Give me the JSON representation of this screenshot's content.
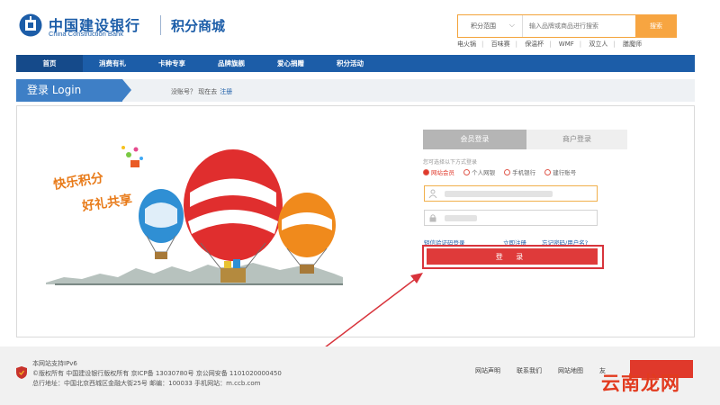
{
  "header": {
    "bank_name_cn": "中国建设银行",
    "bank_name_en": "China Construction Bank",
    "mall_title": "积分商城",
    "search": {
      "scope_label": "积分范围",
      "placeholder": "输入品牌或商品进行搜索",
      "button_label": "搜索"
    },
    "hot_words": [
      "电火锅",
      "百味赛",
      "保温杯",
      "WMF",
      "双立人",
      "膳魔师"
    ]
  },
  "nav": {
    "items": [
      {
        "label": "首页",
        "active": true
      },
      {
        "label": "消费有礼"
      },
      {
        "label": "卡种专享"
      },
      {
        "label": "品牌旗舰"
      },
      {
        "label": "爱心捐赠"
      },
      {
        "label": "积分活动"
      }
    ]
  },
  "login_bar": {
    "title": "登录 Login",
    "no_account_text": "没账号？ 现在去",
    "register_link": "注册"
  },
  "illustration": {
    "slogan_line1": "快乐积分",
    "slogan_line2": "好礼共享"
  },
  "login_form": {
    "tab_member": "会员登录",
    "tab_merchant": "商户登录",
    "methods_hint": "您可选择以下方式登录",
    "methods": [
      {
        "label": "网站会员",
        "selected": true
      },
      {
        "label": "个人网银"
      },
      {
        "label": "手机银行"
      },
      {
        "label": "建行账号"
      }
    ],
    "sms_login_link": "短信验证码登录",
    "register_now_link": "立即注册",
    "forgot_link": "忘记密码/用户名?",
    "login_button": "登 录"
  },
  "footer": {
    "ipv6_text": "本网站支持IPv6",
    "copyright_text": "©版权所有 中国建设银行版权所有 京ICP备 13030780号 京公网安备 1101020000450",
    "address_text": "总行地址：中国北京西城区金融大街25号 邮编：100033 手机网站：m.ccb.com",
    "links": [
      "网站声明",
      "联系我们",
      "网站地图"
    ],
    "truncated_link": "友"
  },
  "watermark": "云南龙网",
  "colors": {
    "brand_blue": "#1c5da8",
    "login_red": "#df3a3a",
    "search_orange": "#f7a541"
  }
}
